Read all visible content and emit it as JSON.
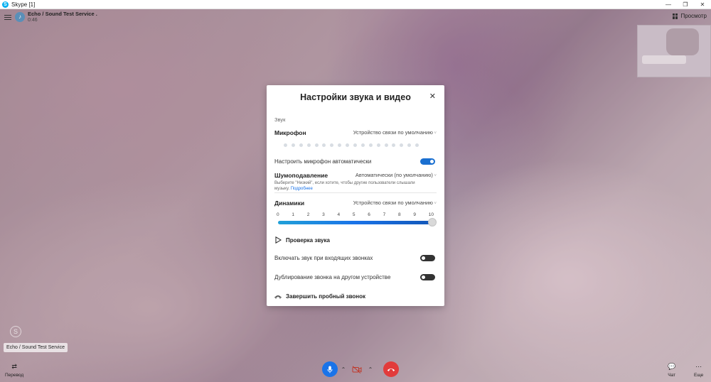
{
  "window": {
    "title": "Skype [1]",
    "controls": [
      "—",
      "❐",
      "✕"
    ]
  },
  "call": {
    "caller_name": "Echo / Sound Test Service .",
    "duration": "0:46",
    "view_label": "Просмотр",
    "caller_tag": "Echo / Sound Test Service"
  },
  "bottom_bar": {
    "translate_label": "Перевод",
    "chat_label": "Чат",
    "more_label": "Еще"
  },
  "dialog": {
    "title": "Настройки звука и видео",
    "audio_section": "Звук",
    "microphone": {
      "label": "Микрофон",
      "value": "Устройство связи по умолчанию",
      "level_dots": 18
    },
    "auto_adjust": {
      "label": "Настроить микрофон автоматически",
      "enabled": true
    },
    "noise": {
      "label": "Шумоподавление",
      "value": "Автоматически (по умолчанию)",
      "hint": "Выберите \"Низкий\", если хотите, чтобы другие пользователи слышали музыку.",
      "link": "Подробнее"
    },
    "speakers": {
      "label": "Динамики",
      "value": "Устройство связи по умолчанию",
      "ticks": [
        "0",
        "1",
        "2",
        "3",
        "4",
        "5",
        "6",
        "7",
        "8",
        "9",
        "10"
      ],
      "volume": 10
    },
    "sound_test": "Проверка звука",
    "incoming_ring": {
      "label": "Включать звук при входящих звонках",
      "enabled": false
    },
    "duplicate_ring": {
      "label": "Дублирование звонка на другом устройстве",
      "enabled": false
    },
    "end_test_call": "Завершить пробный звонок"
  },
  "colors": {
    "accent": "#1a73e8",
    "end_call": "#e23b3b",
    "skype_blue": "#00aff0"
  }
}
